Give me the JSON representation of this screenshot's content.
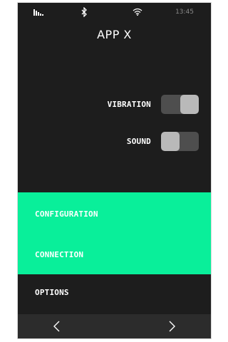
{
  "statusbar": {
    "time": "13:45",
    "icons": [
      "signal-icon",
      "bluetooth-icon",
      "wifi-icon"
    ]
  },
  "header": {
    "title": "APP X"
  },
  "settings": {
    "vibration": {
      "label": "VIBRATION",
      "state": "on"
    },
    "sound": {
      "label": "SOUND",
      "state": "off"
    }
  },
  "menu": {
    "configuration": "CONFIGURATION",
    "connection": "CONNECTION",
    "options": "OPTIONS"
  },
  "navbar": {
    "icons": [
      "chevron-left-icon",
      "chevron-right-icon"
    ]
  },
  "colors": {
    "background": "#1d1d1d",
    "accent": "#09ef9a",
    "navbar": "#2c2c2c",
    "toggle_track": "#4e4e4e",
    "toggle_knob": "#b9b9b9"
  }
}
